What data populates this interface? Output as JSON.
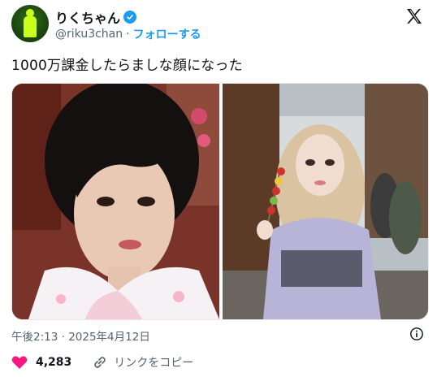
{
  "author": {
    "display_name": "りくちゃん",
    "handle": "@riku3chan",
    "separator": "·",
    "follow_label": "フォローする"
  },
  "tweet": {
    "text": "1000万課金したらましな顔になった",
    "timestamp": "午後2:13 · 2025年4月12日"
  },
  "engagement": {
    "like_count": "4,283",
    "copy_link_label": "リンクをコピー"
  },
  "colors": {
    "accent": "#1d9bf0",
    "like": "#f91880",
    "secondary_text": "#536471"
  },
  "icons": {
    "brand": "x-logo-icon",
    "verified": "verified-badge-icon",
    "like": "heart-icon",
    "copy": "link-icon",
    "info": "info-icon"
  }
}
